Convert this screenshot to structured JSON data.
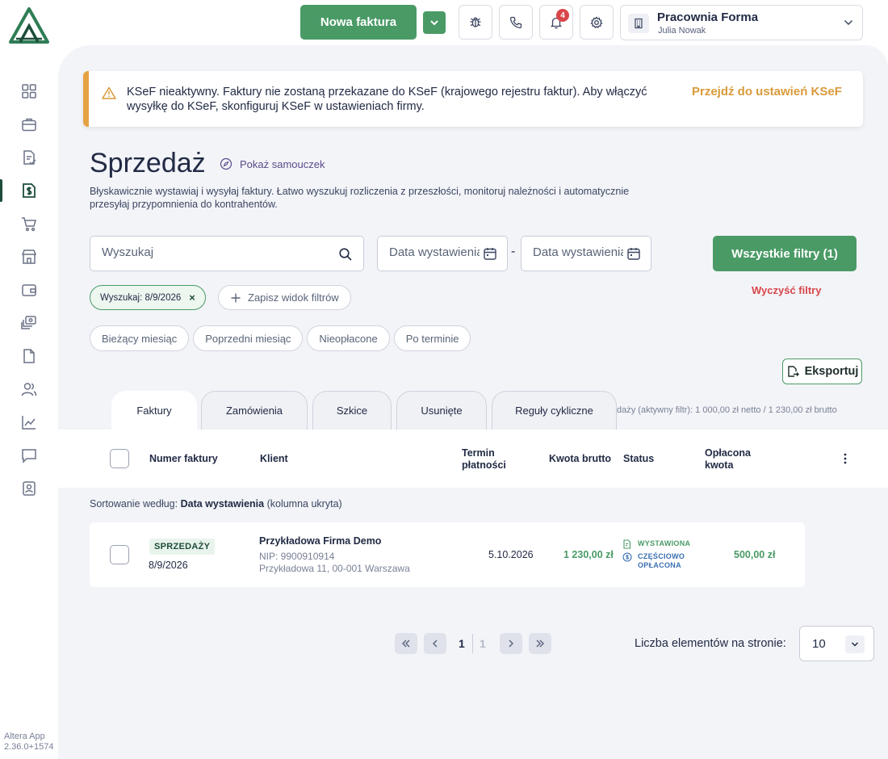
{
  "app": {
    "version_line1": "Altera App",
    "version_line2": "2.36.0+1574"
  },
  "sidebar": {
    "items": [
      {
        "icon": "dashboard-icon"
      },
      {
        "icon": "briefcase-icon"
      },
      {
        "icon": "document-check-icon"
      },
      {
        "icon": "sales-invoice-icon",
        "active": true
      },
      {
        "icon": "cart-icon"
      },
      {
        "icon": "store-icon"
      },
      {
        "icon": "wallet-icon"
      },
      {
        "icon": "money-stack-icon"
      },
      {
        "icon": "file-icon"
      },
      {
        "icon": "users-icon"
      },
      {
        "icon": "chart-icon"
      },
      {
        "icon": "chat-icon"
      },
      {
        "icon": "contact-card-icon"
      }
    ]
  },
  "topbar": {
    "new_invoice_label": "Nowa faktura",
    "notifications_count": "4",
    "company_name": "Pracownia Forma",
    "company_user": "Julia Nowak"
  },
  "alert": {
    "text": "KSeF nieaktywny. Faktury nie zostaną przekazane do KSeF (krajowego rejestru faktur). Aby włączyć wysyłkę do KSeF, skonfiguruj KSeF w ustawieniach firmy.",
    "link": "Przejdź do ustawień KSeF"
  },
  "page": {
    "title": "Sprzedaż",
    "tutorial": "Pokaż samouczek",
    "description": "Błyskawicznie wystawiaj i wysyłaj faktury. Łatwo wyszukuj rozliczenia z przeszłości, monitoruj należności i automatycznie przesyłaj przypomnienia do kontrahentów."
  },
  "filters": {
    "search_placeholder": "Wyszukaj",
    "date_from_placeholder": "Data wystawienia",
    "date_to_placeholder": "Data wystawienia",
    "date_separator": "-",
    "all_filters": "Wszystkie filtry (1)",
    "clear_filters": "Wyczyść filtry",
    "active_chip": "Wyszukaj: 8/9/2026",
    "active_chip_remove": "×",
    "save_view": "Zapisz widok filtrów",
    "quick": [
      "Bieżący miesiąc",
      "Poprzedni miesiąc",
      "Nieopłacone",
      "Po terminie"
    ]
  },
  "export_label": "Eksportuj",
  "tabs": [
    "Faktury",
    "Zamówienia",
    "Szkice",
    "Usunięte",
    "Reguły cykliczne"
  ],
  "summary": "daży (aktywny filtr): 1 000,00 zł netto / 1 230,00 zł brutto",
  "table": {
    "headers": {
      "number": "Numer faktury",
      "client": "Klient",
      "due_line1": "Termin",
      "due_line2": "płatności",
      "gross": "Kwota brutto",
      "status": "Status",
      "paid_line1": "Opłacona",
      "paid_line2": "kwota"
    },
    "sort_prefix": "Sortowanie według:",
    "sort_field": "Data wystawienia",
    "sort_suffix": "(kolumna ukryta)",
    "rows": [
      {
        "type": "SPRZEDAŻY",
        "date": "8/9/2026",
        "client_name": "Przykładowa Firma Demo",
        "client_nip": "NIP: 9900910914",
        "client_address": "Przykładowa 11, 00-001 Warszawa",
        "due": "5.10.2026",
        "gross": "1 230,00 zł",
        "status_issued": "WYSTAWIONA",
        "status_paid_line1": "CZĘŚCIOWO",
        "status_paid_line2": "OPŁACONA",
        "paid": "500,00 zł"
      }
    ]
  },
  "pagination": {
    "current": "1",
    "total": "1",
    "per_page_label": "Liczba elementów na stronie:",
    "per_page_value": "10"
  },
  "colors": {
    "brand_green": "#4a9a66",
    "dark_green": "#1d4d3a",
    "warning": "#e5a243",
    "danger": "#d9464a",
    "status_blue": "#3a6fb0"
  }
}
